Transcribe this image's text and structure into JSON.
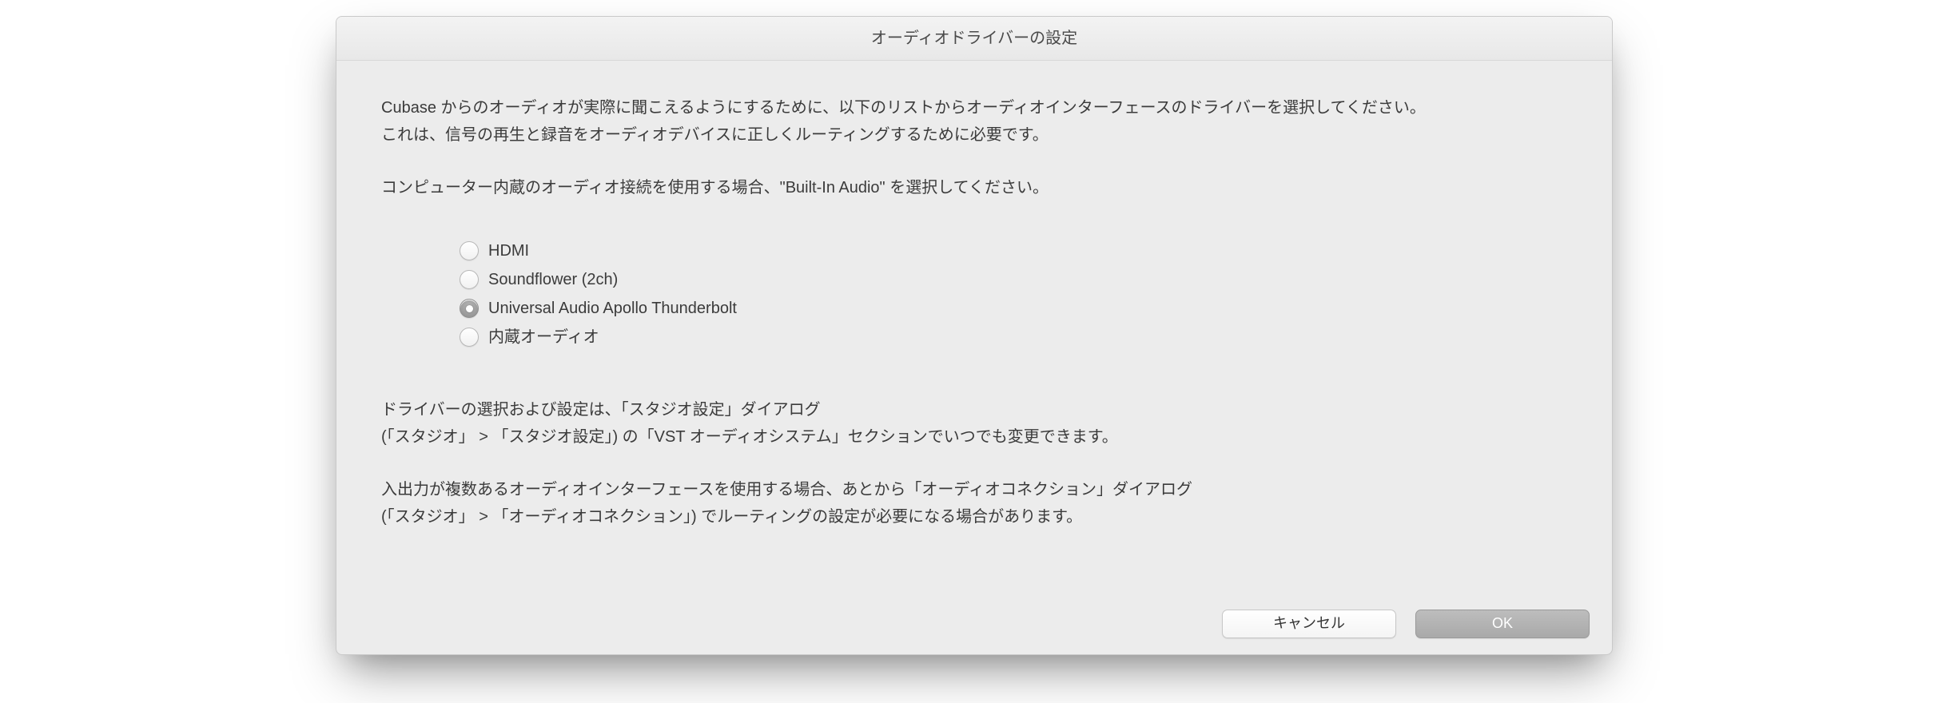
{
  "dialog": {
    "title": "オーディオドライバーの設定",
    "intro_line1": "Cubase からのオーディオが実際に聞こえるようにするために、以下のリストからオーディオインターフェースのドライバーを選択してください。",
    "intro_line2": "これは、信号の再生と録音をオーディオデバイスに正しくルーティングするために必要です。",
    "intro_line3": "コンピューター内蔵のオーディオ接続を使用する場合、\"Built-In Audio\" を選択してください。",
    "options": [
      {
        "label": "HDMI",
        "selected": false
      },
      {
        "label": "Soundflower (2ch)",
        "selected": false
      },
      {
        "label": "Universal Audio Apollo Thunderbolt",
        "selected": true
      },
      {
        "label": "内蔵オーディオ",
        "selected": false
      }
    ],
    "note_line1": "ドライバーの選択および設定は、「スタジオ設定」ダイアログ",
    "note_line2": "(「スタジオ」 > 「スタジオ設定」) の「VST オーディオシステム」セクションでいつでも変更できます。",
    "note_line3": "入出力が複数あるオーディオインターフェースを使用する場合、あとから「オーディオコネクション」ダイアログ",
    "note_line4": "(「スタジオ」 > 「オーディオコネクション」) でルーティングの設定が必要になる場合があります。",
    "buttons": {
      "cancel": "キャンセル",
      "ok": "OK"
    }
  }
}
